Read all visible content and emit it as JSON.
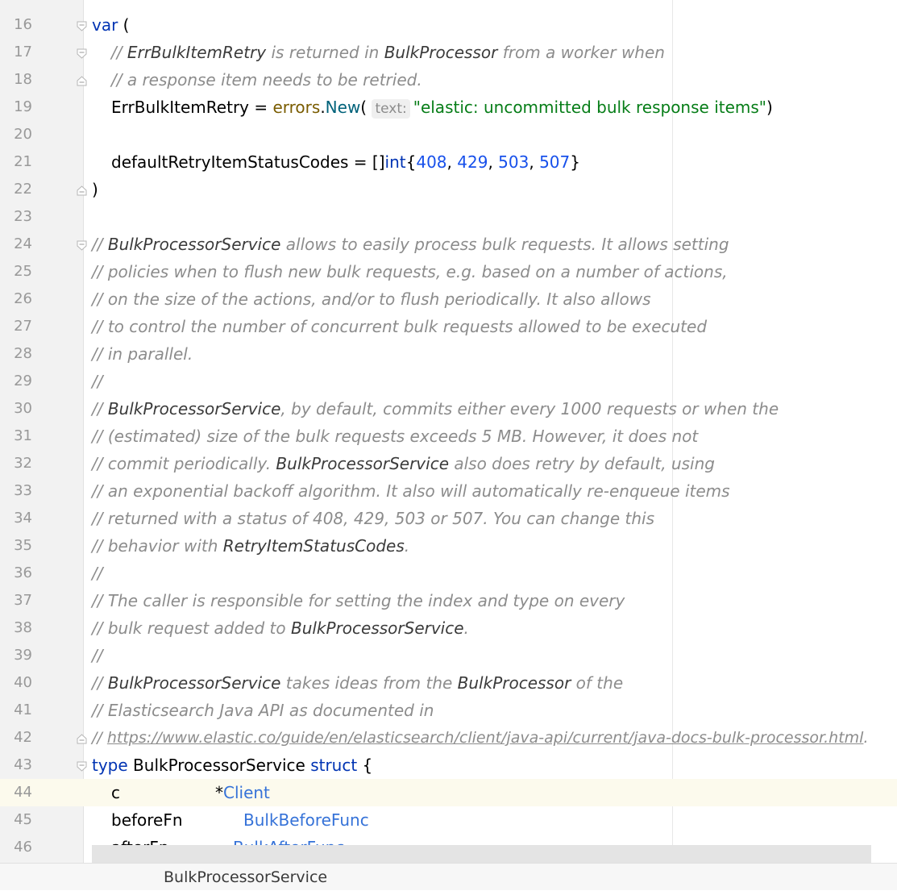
{
  "editor": {
    "current_line": 44,
    "lines": [
      {
        "n": "16",
        "fold": "open"
      },
      {
        "n": "17",
        "fold": "open"
      },
      {
        "n": "18",
        "fold": "close"
      },
      {
        "n": "19"
      },
      {
        "n": "20"
      },
      {
        "n": "21"
      },
      {
        "n": "22",
        "fold": "close"
      },
      {
        "n": "23"
      },
      {
        "n": "24",
        "fold": "open"
      },
      {
        "n": "25"
      },
      {
        "n": "26"
      },
      {
        "n": "27"
      },
      {
        "n": "28"
      },
      {
        "n": "29"
      },
      {
        "n": "30"
      },
      {
        "n": "31"
      },
      {
        "n": "32"
      },
      {
        "n": "33"
      },
      {
        "n": "34"
      },
      {
        "n": "35"
      },
      {
        "n": "36"
      },
      {
        "n": "37"
      },
      {
        "n": "38"
      },
      {
        "n": "39"
      },
      {
        "n": "40"
      },
      {
        "n": "41"
      },
      {
        "n": "42",
        "fold": "close"
      },
      {
        "n": "43",
        "fold": "open"
      },
      {
        "n": "44"
      },
      {
        "n": "45"
      },
      {
        "n": "46"
      }
    ],
    "code": {
      "l16_kw": "var",
      "l16_rest": " (",
      "l17_a": "// ",
      "l17_ref1": "ErrBulkItemRetry",
      "l17_b": " is returned in ",
      "l17_ref2": "BulkProcessor",
      "l17_c": " from a worker when",
      "l18": "// a response item needs to be retried.",
      "l19_var": "ErrBulkItemRetry = ",
      "l19_pkg": "errors",
      "l19_dot": ".",
      "l19_fn": "New",
      "l19_paren": "(",
      "l19_hint": "text:",
      "l19_str": "\"elastic: uncommitted bulk response items\"",
      "l19_close": ")",
      "l21_var": "defaultRetryItemStatusCodes = []",
      "l21_kw": "int",
      "l21_open": "{",
      "l21_n1": "408",
      "l21_c1": ", ",
      "l21_n2": "429",
      "l21_c2": ", ",
      "l21_n3": "503",
      "l21_c3": ", ",
      "l21_n4": "507",
      "l21_close": "}",
      "l22": ")",
      "l24_a": "// ",
      "l24_ref": "BulkProcessorService",
      "l24_b": " allows to easily process bulk requests. It allows setting",
      "l25": "// policies when to flush new bulk requests, e.g. based on a number of actions,",
      "l26": "// on the size of the actions, and/or to flush periodically. It also allows",
      "l27": "// to control the number of concurrent bulk requests allowed to be executed",
      "l28": "// in parallel.",
      "l29": "//",
      "l30_a": "// ",
      "l30_ref": "BulkProcessorService",
      "l30_b": ", by default, commits either every 1000 requests or when the",
      "l31": "// (estimated) size of the bulk requests exceeds 5 MB. However, it does not",
      "l32_a": "// commit periodically. ",
      "l32_ref": "BulkProcessorService",
      "l32_b": " also does retry by default, using",
      "l33": "// an exponential backoff algorithm. It also will automatically re-enqueue items",
      "l34": "// returned with a status of 408, 429, 503 or 507. You can change this",
      "l35_a": "// behavior with ",
      "l35_ref": "RetryItemStatusCodes",
      "l35_b": ".",
      "l36": "//",
      "l37": "// The caller is responsible for setting the index and type on every",
      "l38_a": "// bulk request added to ",
      "l38_ref": "BulkProcessorService",
      "l38_b": ".",
      "l39": "//",
      "l40_a": "// ",
      "l40_ref1": "BulkProcessorService",
      "l40_b": " takes ideas from the ",
      "l40_ref2": "BulkProcessor",
      "l40_c": " of the",
      "l41": "// Elasticsearch Java API as documented in",
      "l42_a": "// ",
      "l42_link": "https://www.elastic.co/guide/en/elasticsearch/client/java-api/current/java-docs-bulk-processor.html",
      "l42_b": ".",
      "l43_kw1": "type",
      "l43_name": " BulkProcessorService ",
      "l43_kw2": "struct",
      "l43_open": " {",
      "l44_field": "c",
      "l44_ptr": "*",
      "l44_type": "Client",
      "l45_field": "beforeFn",
      "l45_type": "BulkBeforeFunc",
      "l46_field": "afterFn",
      "l46_type": "BulkAfterFunc"
    }
  },
  "breadcrumb": {
    "label": "BulkProcessorService"
  }
}
